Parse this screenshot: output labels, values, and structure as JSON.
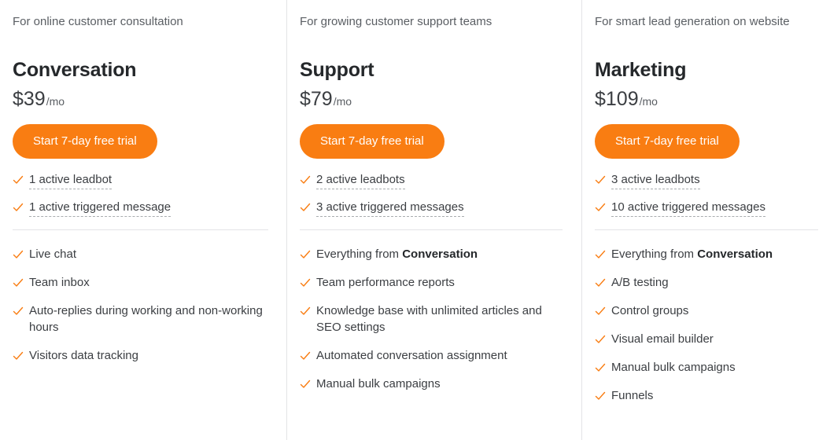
{
  "accent_color": "#f97d12",
  "divider_color": "#e3e4e6",
  "check_icon": "check-icon",
  "plans": [
    {
      "tagline": "For online customer consultation",
      "name": "Conversation",
      "price": "$39",
      "period": "/mo",
      "cta_label": "Start 7-day free trial",
      "quotas": [
        "1 active leadbot",
        "1 active triggered message"
      ],
      "features": [
        {
          "prefix": "Live chat",
          "bold": "",
          "suffix": ""
        },
        {
          "prefix": "Team inbox",
          "bold": "",
          "suffix": ""
        },
        {
          "prefix": "Auto-replies during working and non-working hours",
          "bold": "",
          "suffix": ""
        },
        {
          "prefix": "Visitors data tracking",
          "bold": "",
          "suffix": ""
        }
      ]
    },
    {
      "tagline": "For growing customer support teams",
      "name": "Support",
      "price": "$79",
      "period": "/mo",
      "cta_label": "Start 7-day free trial",
      "quotas": [
        "2 active leadbots",
        "3 active triggered messages"
      ],
      "features": [
        {
          "prefix": "Everything from ",
          "bold": "Conversation",
          "suffix": ""
        },
        {
          "prefix": "Team performance reports",
          "bold": "",
          "suffix": ""
        },
        {
          "prefix": "Knowledge base with unlimited articles and SEO settings",
          "bold": "",
          "suffix": ""
        },
        {
          "prefix": "Automated conversation assignment",
          "bold": "",
          "suffix": ""
        },
        {
          "prefix": "Manual bulk campaigns",
          "bold": "",
          "suffix": ""
        }
      ]
    },
    {
      "tagline": "For smart lead generation on website",
      "name": "Marketing",
      "price": "$109",
      "period": "/mo",
      "cta_label": "Start 7-day free trial",
      "quotas": [
        "3 active leadbots",
        "10 active triggered messages"
      ],
      "features": [
        {
          "prefix": "Everything from ",
          "bold": "Conversation",
          "suffix": ""
        },
        {
          "prefix": "A/B testing",
          "bold": "",
          "suffix": ""
        },
        {
          "prefix": "Control groups",
          "bold": "",
          "suffix": ""
        },
        {
          "prefix": "Visual email builder",
          "bold": "",
          "suffix": ""
        },
        {
          "prefix": "Manual bulk campaigns",
          "bold": "",
          "suffix": ""
        },
        {
          "prefix": "Funnels",
          "bold": "",
          "suffix": ""
        }
      ]
    }
  ]
}
